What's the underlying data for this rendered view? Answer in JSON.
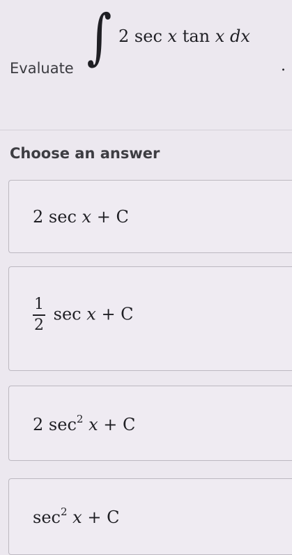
{
  "question": {
    "prefix": "Evaluate",
    "integral_sign": "∫",
    "coefficient": "2",
    "fn1": "sec",
    "var1": "x",
    "fn2": "tan",
    "var2": "x",
    "differential": "dx",
    "period": "."
  },
  "answers": {
    "heading": "Choose an answer",
    "options": [
      {
        "coef": "2",
        "fn": "sec",
        "exp": "",
        "var": "x",
        "tail": "+ C"
      },
      {
        "numerator": "1",
        "denominator": "2",
        "fn": "sec",
        "var": "x",
        "tail": "+ C"
      },
      {
        "coef": "2",
        "fn": "sec",
        "exp": "2",
        "var": "x",
        "tail": "+ C"
      },
      {
        "coef": "",
        "fn": "sec",
        "exp": "2",
        "var": "x",
        "tail": "+ C"
      }
    ]
  }
}
